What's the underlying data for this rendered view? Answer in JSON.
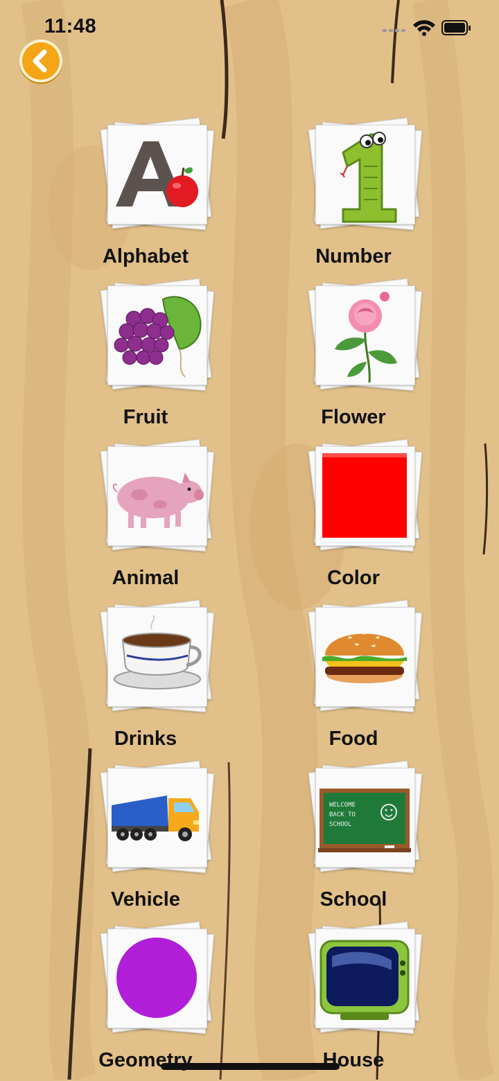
{
  "status_bar": {
    "time": "11:48"
  },
  "categories": [
    {
      "label": "Alphabet",
      "icon": "alphabet-apple-icon"
    },
    {
      "label": "Number",
      "icon": "number-snake-icon"
    },
    {
      "label": "Fruit",
      "icon": "grapes-icon"
    },
    {
      "label": "Flower",
      "icon": "rose-icon"
    },
    {
      "label": "Animal",
      "icon": "pig-icon"
    },
    {
      "label": "Color",
      "icon": "red-square-icon"
    },
    {
      "label": "Drinks",
      "icon": "coffee-cup-icon"
    },
    {
      "label": "Food",
      "icon": "burger-icon"
    },
    {
      "label": "Vehicle",
      "icon": "truck-icon"
    },
    {
      "label": "School",
      "icon": "chalkboard-icon"
    },
    {
      "label": "Geometry",
      "icon": "purple-circle-icon"
    },
    {
      "label": "House",
      "icon": "tv-icon"
    }
  ],
  "chalkboard_text": [
    "WELCOME",
    "BACK TO",
    "SCHOOL"
  ],
  "colors": {
    "wood": "#e2c08a",
    "back_button": "#f5a516",
    "red": "#ff0000",
    "purple": "#b01ed8"
  }
}
